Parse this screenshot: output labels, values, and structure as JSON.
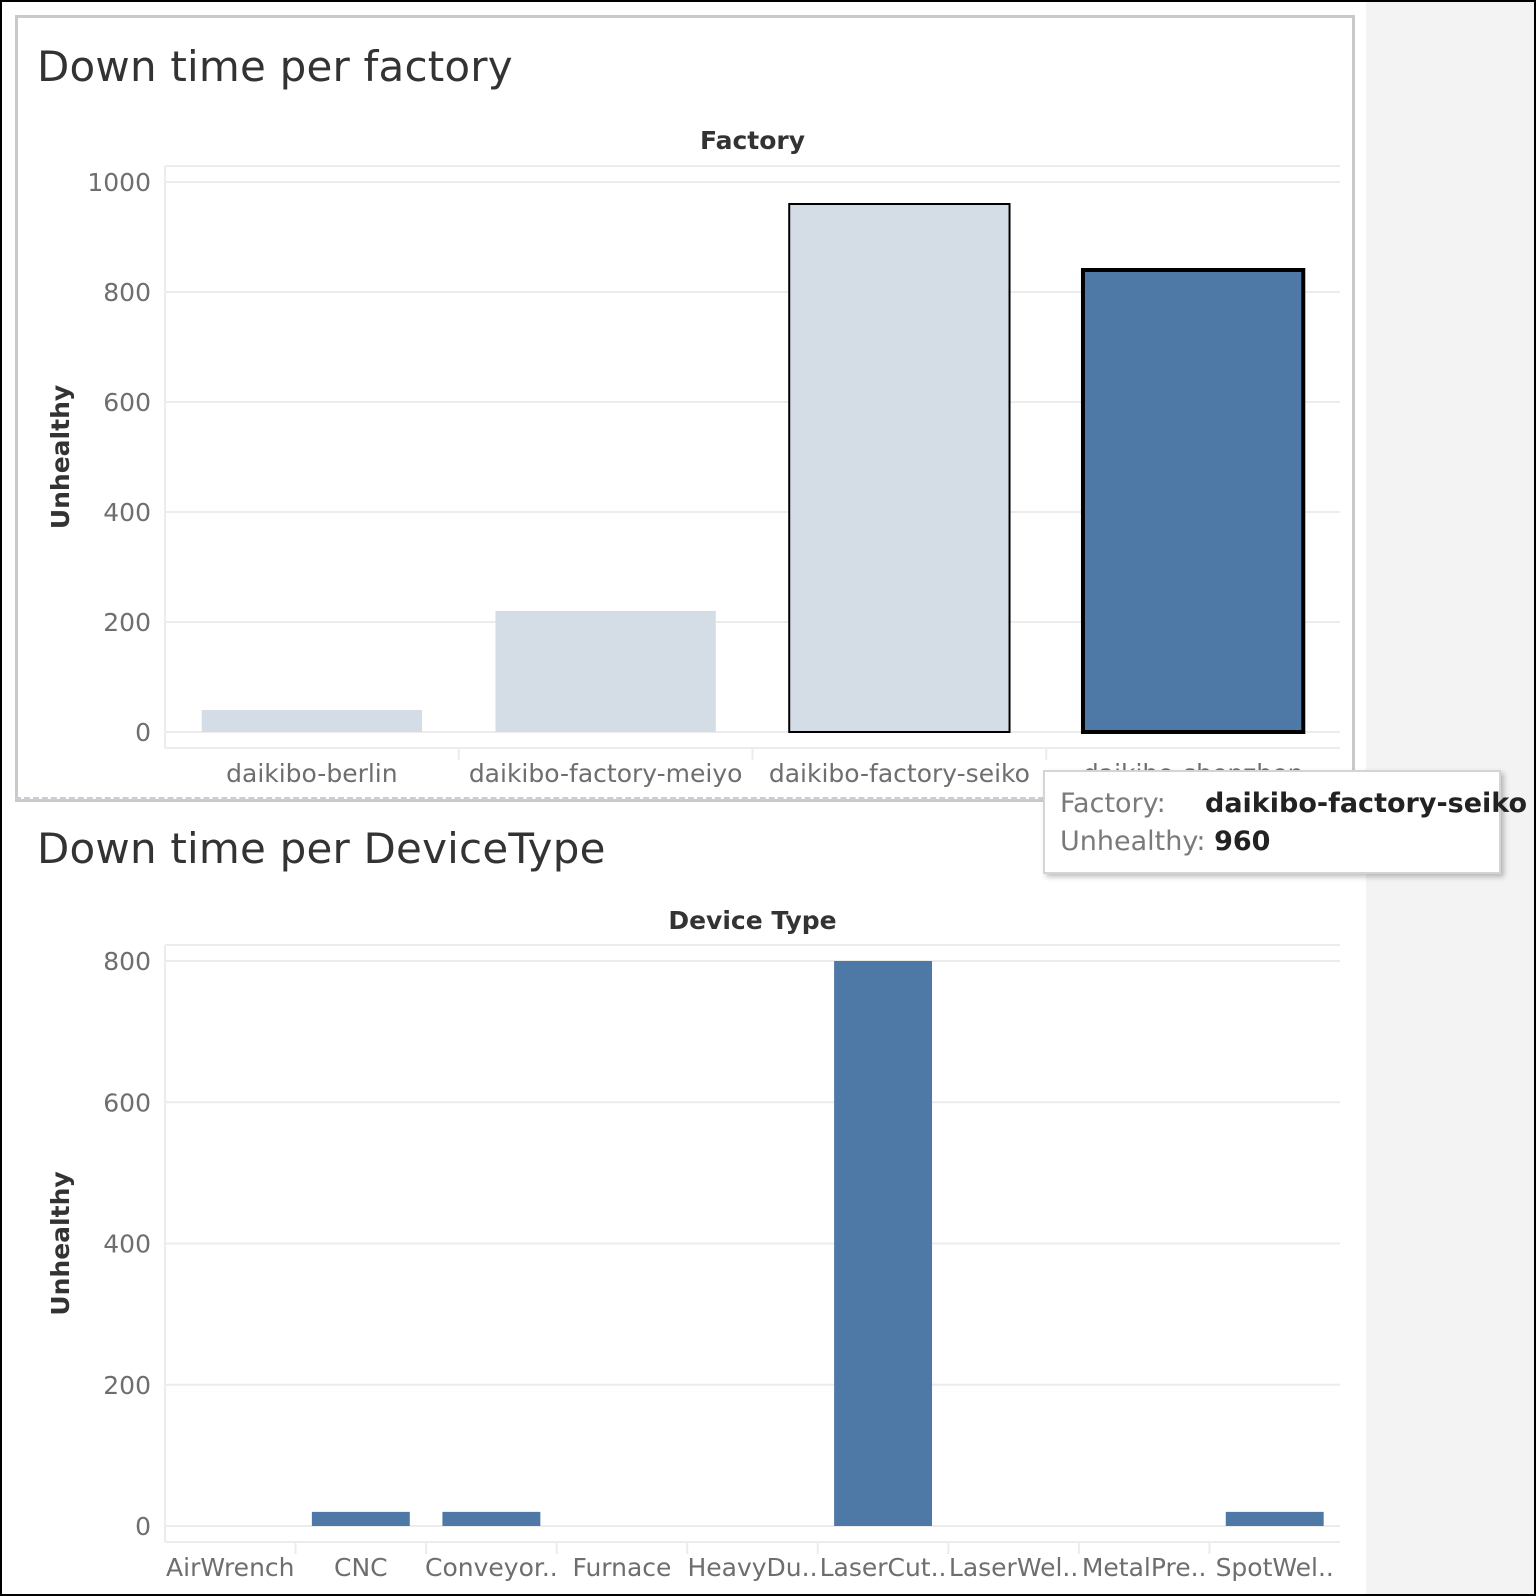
{
  "colors": {
    "accent": "#4e79a7",
    "faded": "#d4dde6",
    "grid": "#ececec",
    "tick_text": "#6e6e6e",
    "label_text": "#333333"
  },
  "tooltip": {
    "factory_key": "Factory:",
    "factory_value": "daikibo-factory-seiko",
    "unhealthy_key": "Unhealthy:",
    "unhealthy_value": "960"
  },
  "chart_data": [
    {
      "type": "bar",
      "title": "Down time per factory",
      "xlabel": "Factory",
      "ylabel": "Unhealthy",
      "categories": [
        "daikibo-berlin",
        "daikibo-factory-meiyo",
        "daikibo-factory-seiko",
        "daikibo-shenzhen"
      ],
      "values": [
        40,
        220,
        960,
        840
      ],
      "yticks": [
        0,
        200,
        400,
        600,
        800,
        1000
      ],
      "ylim": [
        0,
        1000
      ],
      "highlighted_category": "daikibo-shenzhen",
      "hovered_category": "daikibo-factory-seiko",
      "grid": true
    },
    {
      "type": "bar",
      "title": "Down time per DeviceType",
      "xlabel": "Device Type",
      "ylabel": "Unhealthy",
      "categories": [
        "AirWrench",
        "CNC",
        "Conveyor..",
        "Furnace",
        "HeavyDu..",
        "LaserCut..",
        "LaserWel..",
        "MetalPre..",
        "SpotWel.."
      ],
      "values": [
        0,
        20,
        20,
        0,
        0,
        800,
        0,
        0,
        20
      ],
      "yticks": [
        0,
        200,
        400,
        600,
        800
      ],
      "ylim": [
        0,
        800
      ],
      "grid": true
    }
  ]
}
